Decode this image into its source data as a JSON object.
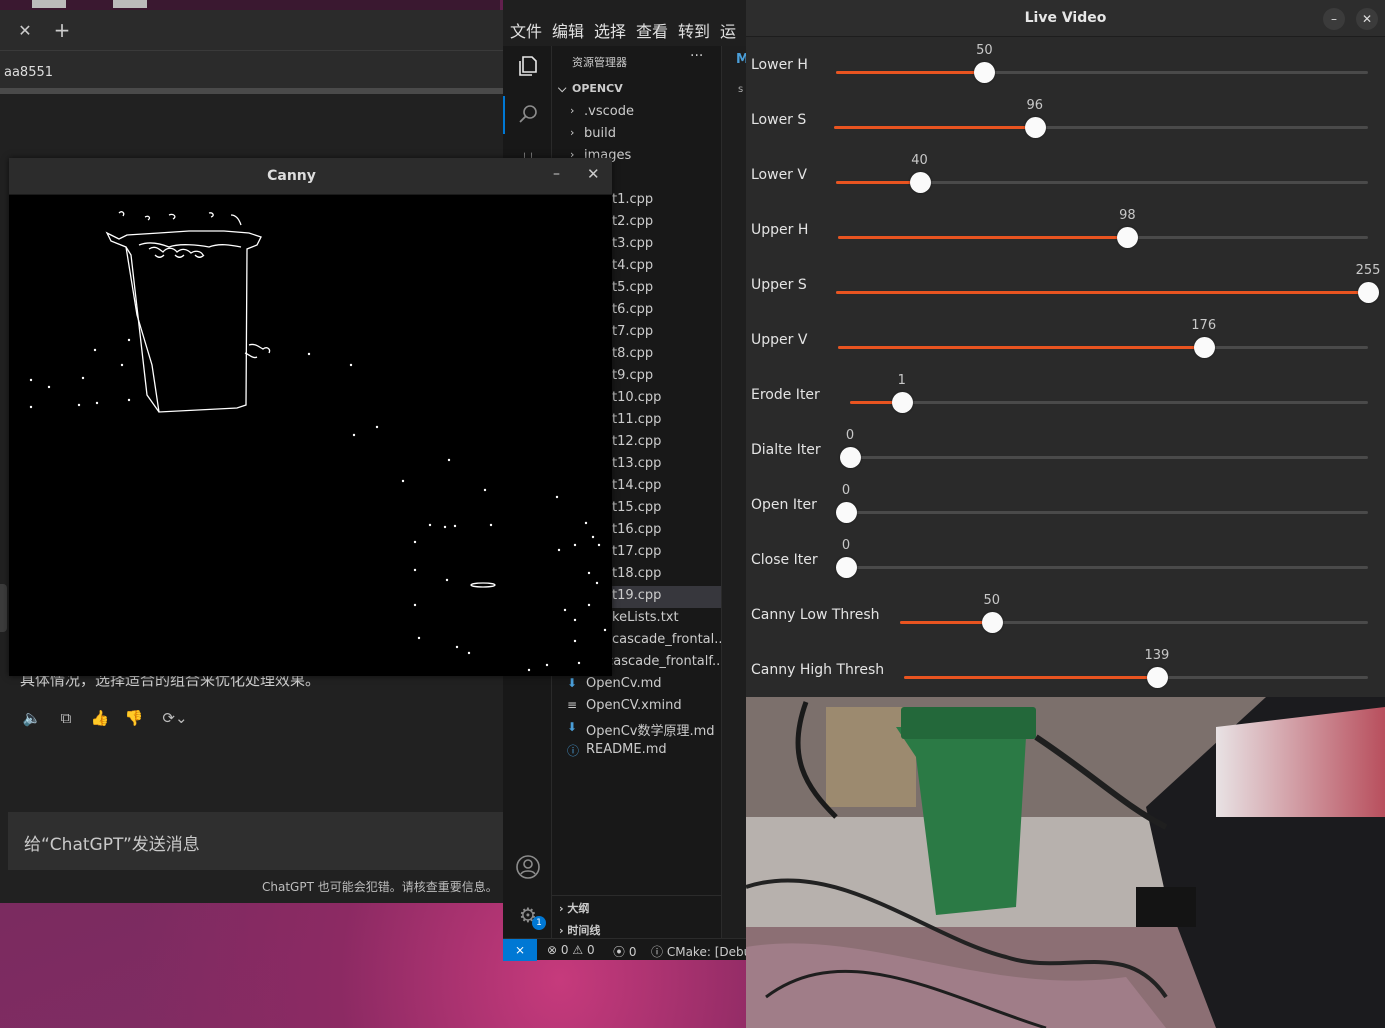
{
  "desktop": {
    "accent": "#7a2a5c"
  },
  "browser": {
    "tab_close_icon": "close-icon",
    "new_tab_icon": "plus-icon",
    "url_fragment": "aa8551",
    "message_tail": "具体情况，选择适合的组合来优化处理效果。",
    "actions": [
      "speaker-icon",
      "copy-icon",
      "thumbs-up-icon",
      "thumbs-down-icon",
      "regenerate-icon"
    ],
    "input_placeholder": "给“ChatGPT”发送消息",
    "disclaimer": "ChatGPT 也可能会犯错。请核查重要信息。"
  },
  "canny": {
    "title": "Canny",
    "minimize": "–",
    "close": "✕"
  },
  "vscode": {
    "menu": [
      "文件",
      "编辑",
      "选择",
      "查看",
      "转到",
      "运行"
    ],
    "explorer_title": "资源管理器",
    "more": "···",
    "root": "OPENCV",
    "folders": [
      ".vscode",
      "build",
      "images",
      "de"
    ],
    "files": [
      "t1.cpp",
      "t2.cpp",
      "t3.cpp",
      "t4.cpp",
      "t5.cpp",
      "t6.cpp",
      "t7.cpp",
      "t8.cpp",
      "t9.cpp",
      "t10.cpp",
      "t11.cpp",
      "t12.cpp",
      "t13.cpp",
      "t14.cpp",
      "t15.cpp",
      "t16.cpp",
      "t17.cpp",
      "t18.cpp",
      "t19.cpp",
      "keLists.txt",
      "cascade_frontal...",
      "lbpcascade_frontalf...",
      "OpenCv.md",
      "OpenCV.xmind",
      "OpenCv数学原理.md",
      "README.md"
    ],
    "selected_file": "t19.cpp",
    "outline": "大纲",
    "timeline": "时间线",
    "badge": "1",
    "editor_tab": "M",
    "editor_hint": "s",
    "status": {
      "errors": "0",
      "warnings": "0",
      "ports": "0",
      "cmake": "CMake: [Debu"
    }
  },
  "live": {
    "title": "Live Video",
    "minimize": "–",
    "close": "✕",
    "sliders": [
      {
        "label": "Lower H",
        "value": "50",
        "fraction": 0.279
      },
      {
        "label": "Lower S",
        "value": "96",
        "fraction": 0.376
      },
      {
        "label": "Lower V",
        "value": "40",
        "fraction": 0.157
      },
      {
        "label": "Upper H",
        "value": "98",
        "fraction": 0.546
      },
      {
        "label": "Upper S",
        "value": "255",
        "fraction": 1.0
      },
      {
        "label": "Upper V",
        "value": "176",
        "fraction": 0.69
      },
      {
        "label": "Erode Iter",
        "value": "1",
        "fraction": 0.1
      },
      {
        "label": "Dialte Iter",
        "value": "0",
        "fraction": 0.0
      },
      {
        "label": "Open Iter",
        "value": "0",
        "fraction": 0.0
      },
      {
        "label": "Close Iter",
        "value": "0",
        "fraction": 0.0
      },
      {
        "label": "Canny Low Thresh",
        "value": "50",
        "fraction": 0.196
      },
      {
        "label": "Canny High Thresh",
        "value": "139",
        "fraction": 0.545
      }
    ],
    "accent": "#e95420"
  }
}
